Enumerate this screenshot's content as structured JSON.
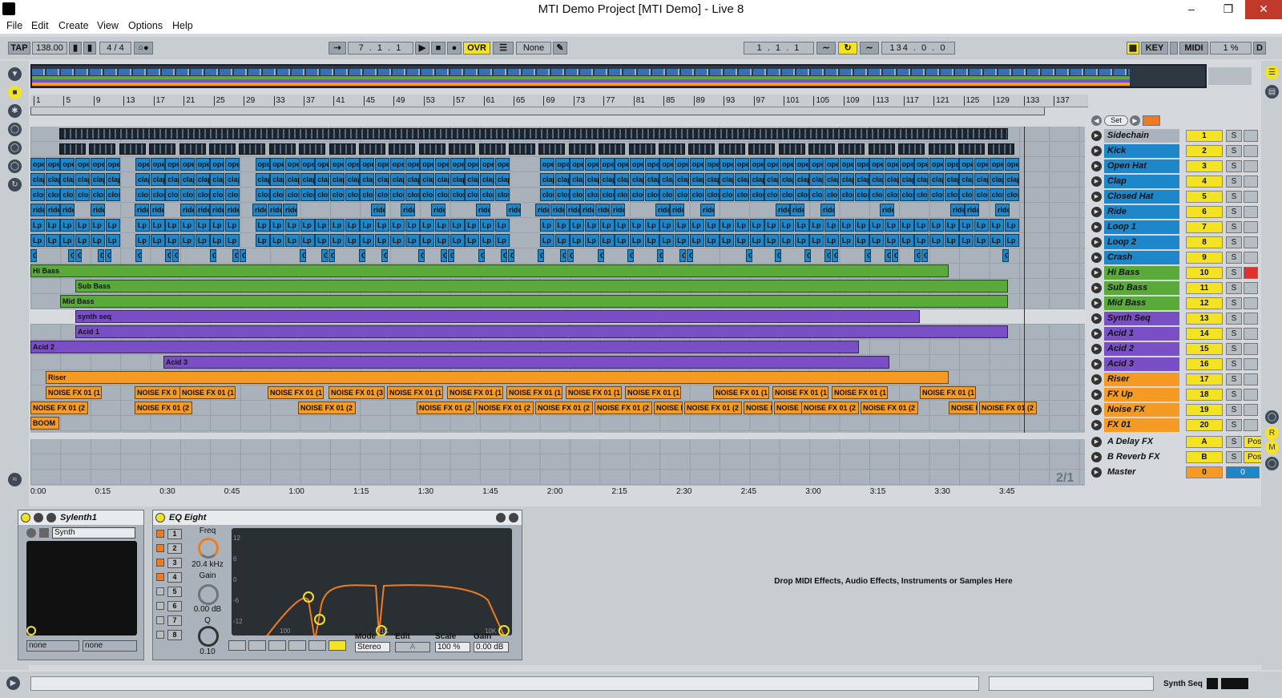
{
  "window": {
    "title": "MTI Demo Project  [MTI Demo] - Live 8",
    "minimize": "–",
    "restore": "❐",
    "close": "✕"
  },
  "menu": [
    "File",
    "Edit",
    "Create",
    "View",
    "Options",
    "Help"
  ],
  "transport": {
    "tap": "TAP",
    "tempo": "138.00",
    "meter": "4 / 4",
    "position": "7 .  1 .  1",
    "ovr": "OVR",
    "none": "None",
    "loop_start": "1 .  1 .  1",
    "loop_length": "134 .  0 .  0",
    "key": "KEY",
    "midi": "MIDI",
    "cpu": "1 %",
    "d": "D"
  },
  "ruler": [
    "1",
    "5",
    "9",
    "13",
    "17",
    "21",
    "25",
    "29",
    "33",
    "37",
    "41",
    "45",
    "49",
    "53",
    "57",
    "61",
    "65",
    "69",
    "73",
    "77",
    "81",
    "85",
    "89",
    "93",
    "97",
    "101",
    "105",
    "109",
    "113",
    "117",
    "121",
    "125",
    "129",
    "133",
    "137"
  ],
  "time_ruler": [
    "0:00",
    "0:15",
    "0:30",
    "0:45",
    "1:00",
    "1:15",
    "1:30",
    "1:45",
    "2:00",
    "2:15",
    "2:30",
    "2:45",
    "3:00",
    "3:15",
    "3:30",
    "3:45"
  ],
  "zoom_label": "2/1",
  "session": {
    "set_label": "Set"
  },
  "tracks": [
    {
      "name": "Sidechain",
      "num": "1",
      "color": "#aab3bb"
    },
    {
      "name": "Kick",
      "num": "2",
      "color": "#1d87c9"
    },
    {
      "name": "Open Hat",
      "num": "3",
      "color": "#1d87c9"
    },
    {
      "name": "Clap",
      "num": "4",
      "color": "#1d87c9"
    },
    {
      "name": "Closed Hat",
      "num": "5",
      "color": "#1d87c9"
    },
    {
      "name": "Ride",
      "num": "6",
      "color": "#1d87c9"
    },
    {
      "name": "Loop 1",
      "num": "7",
      "color": "#1d87c9"
    },
    {
      "name": "Loop 2",
      "num": "8",
      "color": "#1d87c9"
    },
    {
      "name": "Crash",
      "num": "9",
      "color": "#1d87c9"
    },
    {
      "name": "Hi Bass",
      "num": "10",
      "color": "#5aaa3a"
    },
    {
      "name": "Sub Bass",
      "num": "11",
      "color": "#5aaa3a"
    },
    {
      "name": "Mid Bass",
      "num": "12",
      "color": "#5aaa3a"
    },
    {
      "name": "Synth Seq",
      "num": "13",
      "color": "#7a4ec4"
    },
    {
      "name": "Acid 1",
      "num": "14",
      "color": "#7a4ec4"
    },
    {
      "name": "Acid 2",
      "num": "15",
      "color": "#7a4ec4"
    },
    {
      "name": "Acid 3",
      "num": "16",
      "color": "#7a4ec4"
    },
    {
      "name": "Riser",
      "num": "17",
      "color": "#f59a22"
    },
    {
      "name": "FX Up",
      "num": "18",
      "color": "#f59a22"
    },
    {
      "name": "Noise FX",
      "num": "19",
      "color": "#f59a22"
    },
    {
      "name": "FX 01",
      "num": "20",
      "color": "#f59a22"
    }
  ],
  "returns": [
    {
      "name": "A Delay FX",
      "num": "A",
      "post": "Post"
    },
    {
      "name": "B Reverb FX",
      "num": "B",
      "post": "Post"
    },
    {
      "name": "Master",
      "num": "0",
      "post": "0"
    }
  ],
  "clips": {
    "open_hat": "ope",
    "clap": "clap",
    "closed_hat": "clos",
    "ride": "ride",
    "loop": "Lp",
    "crash": "C",
    "hi_bass": "Hi Bass",
    "sub_bass": "Sub Bass",
    "mid_bass": "Mid Bass",
    "synth_seq": "synth seq",
    "acid1": "Acid 1",
    "acid2": "Acid 2",
    "acid3": "Acid 3",
    "riser": "Riser",
    "fx_up": [
      "NOISE FX 01 (1",
      "NOISE FX 0",
      "NOISE FX 01 (1",
      "NOISE FX 01 (1",
      "NOISE FX 01 (3",
      "NOISE FX 01 (1",
      "NOISE FX 01 (1",
      "NOISE FX 01 (1",
      "NOISE FX 01 (1",
      "NOISE FX 01 (1",
      "NOISE FX 01 (1",
      "NOISE FX 01 (1",
      "NOISE FX 01 (1",
      "NOISE FX 01 (1"
    ],
    "noise_fx": [
      "NOISE FX 01 (2",
      "NOISE FX 01 (2",
      "NOISE FX 01 (2",
      "NOISE FX 01 (2",
      "NOISE FX 01 (2",
      "NOISE FX 01 (2",
      "NOISE FX 01 (2",
      "NOISE F",
      "NOISE FX 01 (2",
      "NOISE F",
      "NOISE F",
      "NOISE FX 01 (2",
      "NOISE FX 01 (2",
      "NOISE F",
      "NOISE FX 01 (2"
    ],
    "fx01": "BOOM"
  },
  "devices": {
    "sylenth": {
      "title": "Sylenth1",
      "preset": "Synth",
      "in1": "none",
      "in2": "none"
    },
    "eq": {
      "title": "EQ Eight",
      "freq_label": "Freq",
      "freq_value": "20.4 kHz",
      "gain_label": "Gain",
      "gain_value": "0.00 dB",
      "q_label": "Q",
      "q_value": "0.10",
      "bands": [
        "1",
        "2",
        "3",
        "4",
        "5",
        "6",
        "7",
        "8"
      ],
      "db_ticks": [
        "12",
        "6",
        "0",
        "-6",
        "-12"
      ],
      "hz_ticks": [
        "100",
        "1K",
        "10K"
      ],
      "mode_label": "Mode",
      "mode_value": "Stereo",
      "edit_label": "Edit",
      "edit_value": "A",
      "scale_label": "Scale",
      "scale_value": "100 %",
      "gain2_label": "Gain",
      "gain2_value": "0.00 dB"
    },
    "drop_text": "Drop MIDI Effects, Audio Effects, Instruments or Samples Here"
  },
  "status": {
    "track_label": "Synth Seq"
  }
}
